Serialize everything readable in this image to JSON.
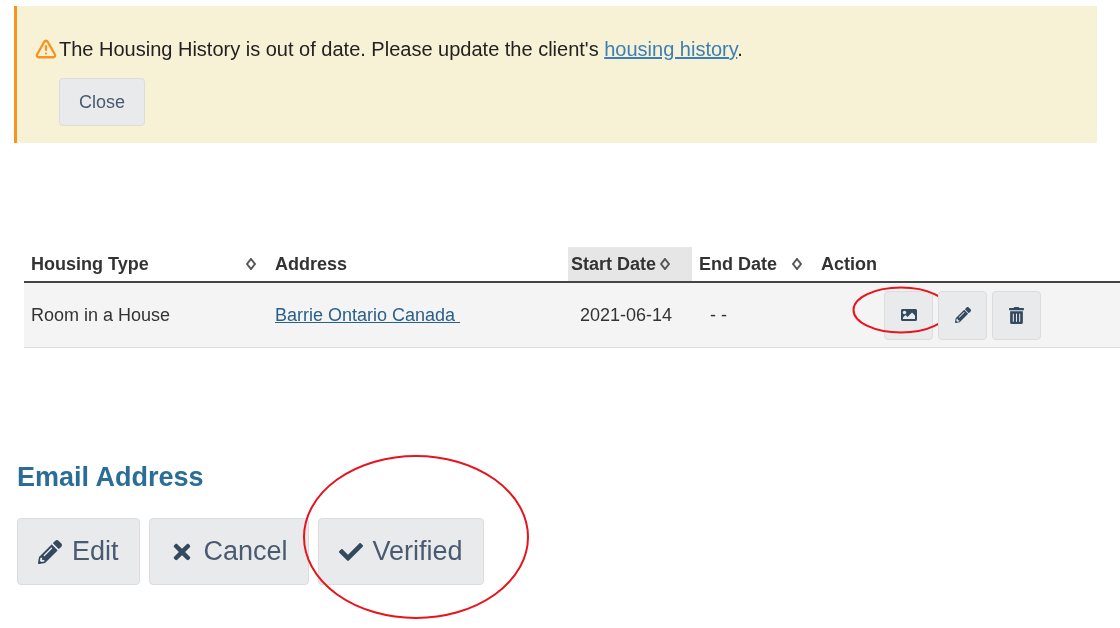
{
  "alert": {
    "message": "The Housing History is out of date. Please update the client's ",
    "link": "housing history",
    "trailing": ".",
    "close_button": "Close"
  },
  "housing_table": {
    "columns": [
      {
        "label": "Housing Type",
        "sorted": false
      },
      {
        "label": "Address",
        "sorted": false
      },
      {
        "label": "Start Date",
        "sorted": true
      },
      {
        "label": "End Date",
        "sorted": false
      },
      {
        "label": "Action",
        "sorted": false
      }
    ],
    "rows": [
      {
        "housing_type": "Room in a House",
        "address": "Barrie Ontario Canada ",
        "start_date": "2021-06-14",
        "end_date": "- -",
        "actions": [
          {
            "kind": "image",
            "circled": true
          },
          {
            "kind": "edit",
            "circled": false
          },
          {
            "kind": "delete",
            "circled": false
          }
        ]
      }
    ]
  },
  "email_section": {
    "title": "Email Address",
    "buttons": [
      {
        "kind": "edit",
        "label": "Edit",
        "circled": false
      },
      {
        "kind": "cancel",
        "label": "Cancel",
        "circled": false
      },
      {
        "kind": "verified",
        "label": "Verified",
        "circled": true
      }
    ]
  }
}
